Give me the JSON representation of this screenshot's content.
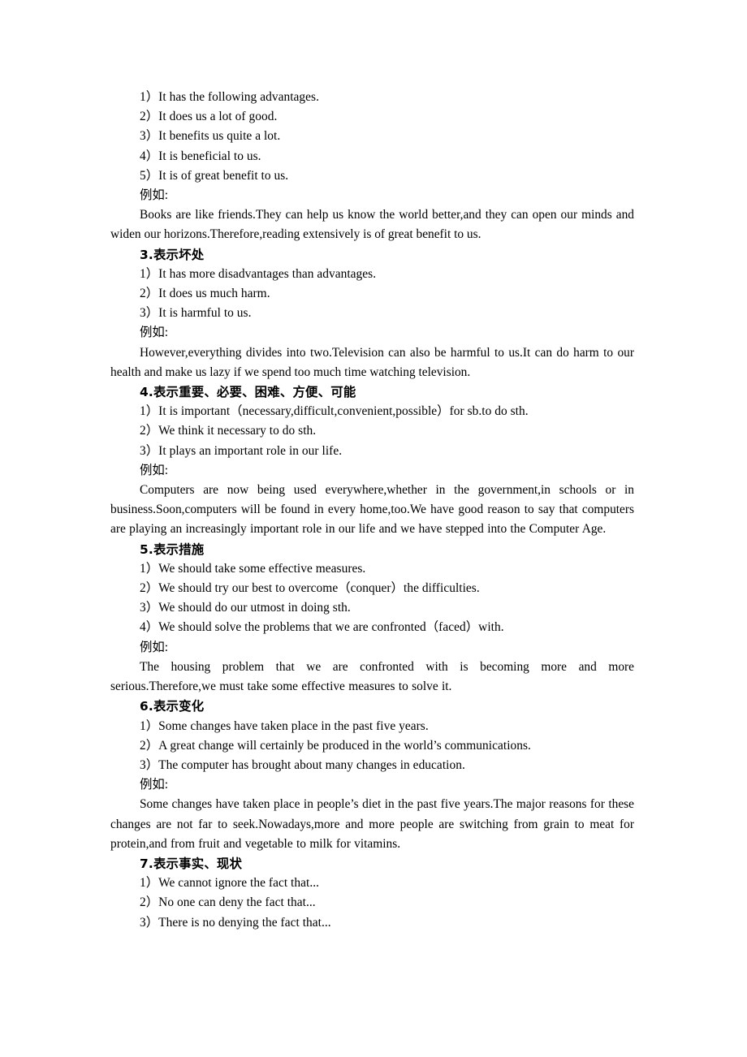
{
  "document": {
    "page_background": "#ffffff",
    "text_color": "#000000",
    "example_label": "例如:"
  },
  "blocks": [
    {
      "kind": "item",
      "text": "1）It has the following advantages."
    },
    {
      "kind": "item",
      "text": "2）It does us a lot of good."
    },
    {
      "kind": "item",
      "text": "3）It benefits us quite a lot."
    },
    {
      "kind": "item",
      "text": "4）It is beneficial to us."
    },
    {
      "kind": "item",
      "text": "5）It is of great benefit to us."
    },
    {
      "kind": "label",
      "text": "例如:"
    },
    {
      "kind": "para",
      "text": "Books are like friends.They can help us know the world better,and they can open our minds and widen our horizons.Therefore,reading extensively is of great benefit to us."
    },
    {
      "kind": "heading",
      "text": "3.表示坏处"
    },
    {
      "kind": "item",
      "text": "1）It has more disadvantages than advantages."
    },
    {
      "kind": "item",
      "text": "2）It does us much harm."
    },
    {
      "kind": "item",
      "text": "3）It is harmful to us."
    },
    {
      "kind": "label",
      "text": "例如:"
    },
    {
      "kind": "para",
      "text": "However,everything divides into two.Television can also be harmful to us.It can do harm to our health and make us lazy if we spend too much time watching television."
    },
    {
      "kind": "heading",
      "text": "4.表示重要、必要、困难、方便、可能"
    },
    {
      "kind": "item",
      "text": "1）It is important（necessary,difficult,convenient,possible）for sb.to do sth."
    },
    {
      "kind": "item",
      "text": "2）We think it necessary to do sth."
    },
    {
      "kind": "item",
      "text": "3）It plays an important role in our life."
    },
    {
      "kind": "label",
      "text": "例如:"
    },
    {
      "kind": "para_stretch",
      "text": "Computers are now being used everywhere,whether in the government,in schools or in business.Soon,computers will be found in every home,too.We have good reason to say that computers are playing an increasingly important role in our life and we have stepped into the Computer Age."
    },
    {
      "kind": "heading",
      "text": "5.表示措施"
    },
    {
      "kind": "item",
      "text": "1）We should take some effective measures."
    },
    {
      "kind": "item",
      "text": "2）We should try our best to overcome（conquer）the difficulties."
    },
    {
      "kind": "item",
      "text": "3）We should do our utmost in doing sth."
    },
    {
      "kind": "item",
      "text": "4）We should solve the problems that we are confronted（faced）with."
    },
    {
      "kind": "label",
      "text": "例如:"
    },
    {
      "kind": "para_stretch",
      "text": "The housing problem that we are confronted with is becoming more and more serious.Therefore,we must take some effective measures to solve it."
    },
    {
      "kind": "heading",
      "text": "6.表示变化"
    },
    {
      "kind": "item",
      "text": "1）Some changes have taken place in the past five years."
    },
    {
      "kind": "item",
      "text": "2）A great change will certainly be produced in the world’s communications."
    },
    {
      "kind": "item",
      "text": "3）The computer has brought about many changes in education."
    },
    {
      "kind": "label",
      "text": "例如:"
    },
    {
      "kind": "para_stretch",
      "text": "Some changes have taken place in people’s diet in the past five years.The major reasons for these changes are not far to seek.Nowadays,more and more people are switching from grain to meat for protein,and from fruit and vegetable to milk for vitamins."
    },
    {
      "kind": "heading",
      "text": "7.表示事实、现状"
    },
    {
      "kind": "item",
      "text": "1）We cannot ignore the fact that..."
    },
    {
      "kind": "item",
      "text": "2）No one can deny the fact that..."
    },
    {
      "kind": "item",
      "text": "3）There is no denying the fact that..."
    }
  ]
}
